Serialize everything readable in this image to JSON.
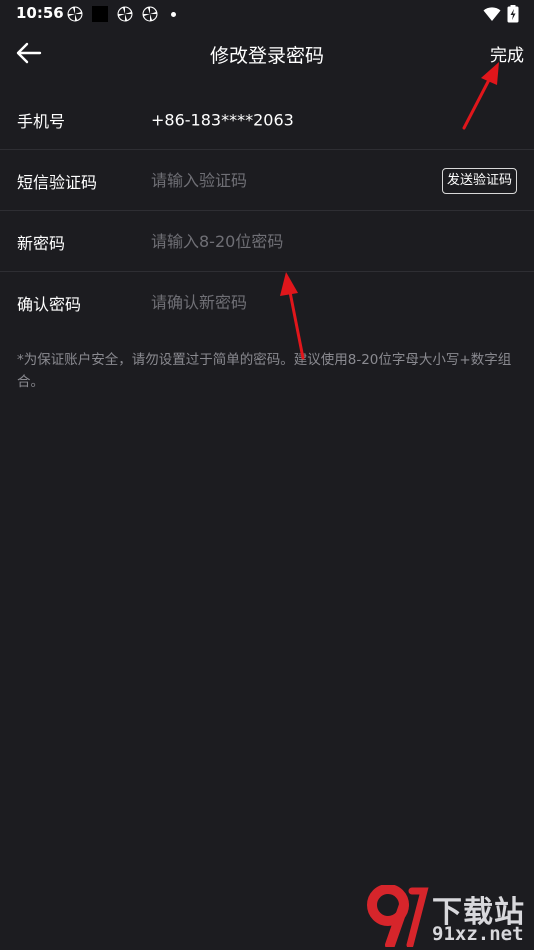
{
  "status_bar": {
    "time": "10:56",
    "icons": [
      "pinwheel-icon",
      "black-square-icon",
      "pinwheel-icon",
      "pinwheel-icon",
      "dot-icon",
      "wifi-icon",
      "battery-charging-icon"
    ]
  },
  "header": {
    "title": "修改登录密码",
    "done_label": "完成",
    "back_icon": "arrow-left-icon"
  },
  "form": {
    "phone": {
      "label": "手机号",
      "value": "+86-183****2063"
    },
    "sms_code": {
      "label": "短信验证码",
      "placeholder": "请输入验证码",
      "button_label": "发送验证码"
    },
    "new_password": {
      "label": "新密码",
      "placeholder": "请输入8-20位密码"
    },
    "confirm_password": {
      "label": "确认密码",
      "placeholder": "请确认新密码"
    }
  },
  "hint": "*为保证账户安全，请勿设置过于简单的密码。建议使用8-20位字母大小写+数字组合。",
  "watermark": {
    "title": "下载站",
    "url": "91xz.net",
    "logo_text": "9"
  },
  "colors": {
    "background": "#1c1c20",
    "divider": "#2e2e33",
    "placeholder": "#6f6f75",
    "hint": "#8a8a90",
    "annotation_arrow": "#e0161b",
    "watermark_red": "#d6252b"
  }
}
